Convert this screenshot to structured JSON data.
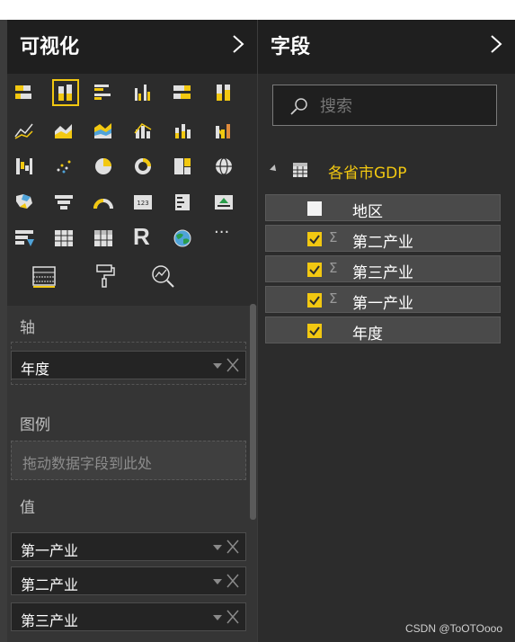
{
  "visualizations": {
    "title": "可视化",
    "expand_icon": "chevron-right-icon",
    "gallery_icons": [
      "stacked-bar-icon",
      "stacked-column-icon",
      "clustered-bar-icon",
      "clustered-column-icon",
      "100-stacked-bar-icon",
      "100-stacked-column-icon",
      "line-chart-icon",
      "area-chart-icon",
      "stacked-area-icon",
      "line-and-column-icon",
      "line-and-stacked-column-icon",
      "ribbon-chart-icon",
      "waterfall-icon",
      "scatter-icon",
      "pie-icon",
      "donut-icon",
      "treemap-icon",
      "map-icon",
      "filled-map-icon",
      "funnel-icon",
      "gauge-icon",
      "card-icon",
      "multi-row-card-icon",
      "kpi-icon",
      "slicer-icon",
      "table-icon",
      "matrix-icon",
      "r-visual-icon",
      "globe-icon",
      "more-icon"
    ],
    "r_label": "R",
    "more_label": "···",
    "card_label": "123",
    "tabs": [
      "fields-tab-icon",
      "format-paint-roller-icon",
      "analytics-magnifier-icon"
    ],
    "axis_label": "轴",
    "axis_fields": [
      "年度"
    ],
    "legend_label": "图例",
    "legend_placeholder": "拖动数据字段到此处",
    "values_label": "值",
    "value_fields": [
      "第一产业",
      "第二产业",
      "第三产业"
    ]
  },
  "fields": {
    "title": "字段",
    "expand_icon": "chevron-right-icon",
    "search_placeholder": "搜索",
    "table_name": "各省市GDP",
    "items": [
      {
        "label": "地区",
        "checked": false,
        "sigma": ""
      },
      {
        "label": "第二产业",
        "checked": true,
        "sigma": "Σ"
      },
      {
        "label": "第三产业",
        "checked": true,
        "sigma": "Σ"
      },
      {
        "label": "第一产业",
        "checked": true,
        "sigma": "Σ"
      },
      {
        "label": "年度",
        "checked": true,
        "sigma": ""
      }
    ]
  },
  "watermark": "CSDN @ToOTOooo",
  "colors": {
    "accent": "#f2c811",
    "panel": "#2c2c2c",
    "header": "#1f1f1f"
  }
}
